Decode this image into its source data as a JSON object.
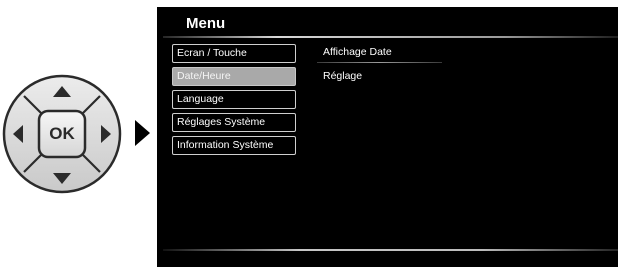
{
  "dpad": {
    "center_label": "OK",
    "icons": [
      "up-arrow-icon",
      "down-arrow-icon",
      "left-arrow-icon",
      "right-arrow-icon"
    ]
  },
  "menu": {
    "title": "Menu",
    "items": [
      {
        "label": "Ecran / Touche",
        "selected": false
      },
      {
        "label": "Date/Heure",
        "selected": true
      },
      {
        "label": "Language",
        "selected": false
      },
      {
        "label": "Réglages Système",
        "selected": false
      },
      {
        "label": "Information Système",
        "selected": false
      }
    ]
  },
  "submenu": {
    "items": [
      {
        "label": "Affichage Date"
      },
      {
        "label": "Réglage"
      }
    ]
  },
  "colors": {
    "screen_background": "#000000",
    "selected_item": "#a9a9a9",
    "item_border": "#cfcfcf",
    "text": "#ffffff"
  }
}
